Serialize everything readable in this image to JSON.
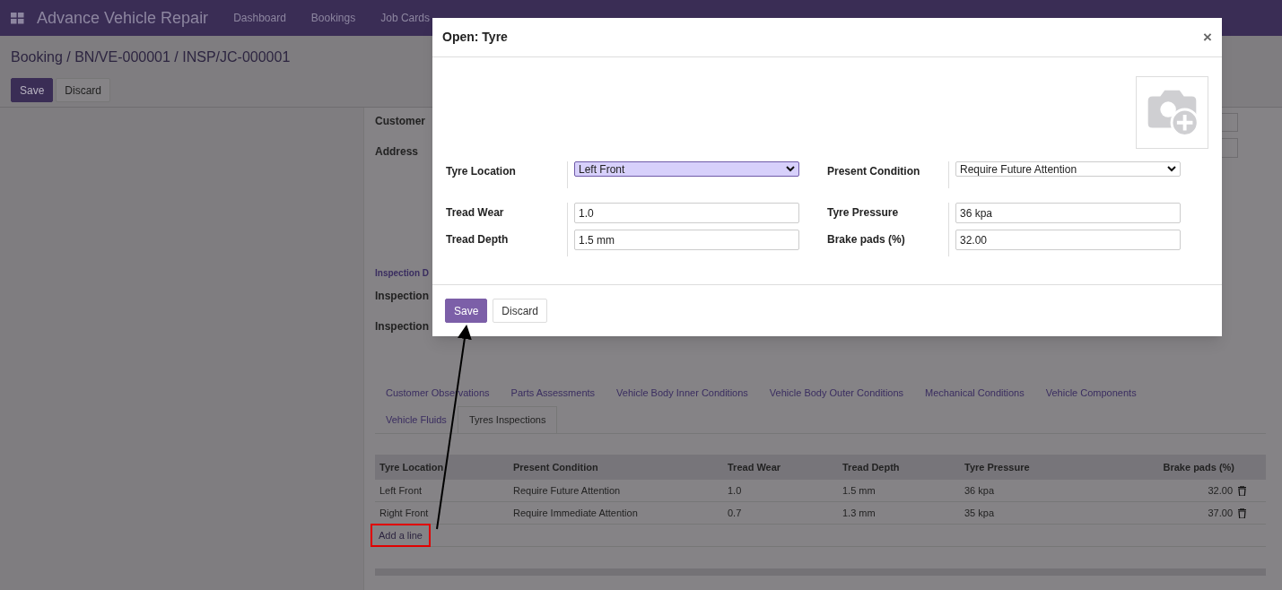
{
  "navbar": {
    "title": "Advance Vehicle Repair",
    "items": [
      "Dashboard",
      "Bookings",
      "Job Cards"
    ]
  },
  "breadcrumb": "Booking / BN/VE-000001 / INSP/JC-000001",
  "actions": [
    {
      "label": "Save",
      "kind": "primary"
    },
    {
      "label": "Discard",
      "kind": "secondary"
    }
  ],
  "form": {
    "labels": [
      "Customer",
      "Address"
    ],
    "section": "Inspection D",
    "more_labels": [
      "Inspection",
      "Inspection"
    ]
  },
  "tabs": [
    {
      "label": "Customer Observations",
      "selected": false
    },
    {
      "label": "Parts Assessments",
      "selected": false
    },
    {
      "label": "Vehicle Body Inner Conditions",
      "selected": false
    },
    {
      "label": "Vehicle Body Outer Conditions",
      "selected": false
    },
    {
      "label": "Mechanical Conditions",
      "selected": false
    },
    {
      "label": "Vehicle Components",
      "selected": false
    },
    {
      "label": "Vehicle Fluids",
      "selected": false
    },
    {
      "label": "Tyres Inspections",
      "selected": true
    }
  ],
  "table": {
    "columns": [
      "Tyre Location",
      "Present Condition",
      "Tread Wear",
      "Tread Depth",
      "Tyre Pressure",
      "Brake pads (%)"
    ],
    "rows": [
      [
        "Left Front",
        "Require Future Attention",
        "1.0",
        "1.5 mm",
        "36 kpa",
        "32.00"
      ],
      [
        "Right Front",
        "Require Immediate Attention",
        "0.7",
        "1.3 mm",
        "35 kpa",
        "37.00"
      ]
    ],
    "add_line": "Add a line"
  },
  "dialog": {
    "title": "Open: Tyre",
    "close": "×",
    "fields": [
      {
        "label": "Tyre Location",
        "kind": "select",
        "value": "Left Front",
        "focused": true
      },
      {
        "label": "Present Condition",
        "kind": "select",
        "value": "Require Future Attention",
        "focused": false
      },
      {
        "label": "Tread Wear",
        "kind": "input",
        "value": "1.0",
        "focused": false
      },
      {
        "label": "Tyre Pressure",
        "kind": "input",
        "value": "36 kpa",
        "focused": false
      },
      {
        "label": "Tread Depth",
        "kind": "input",
        "value": "1.5 mm",
        "focused": false
      },
      {
        "label": "Brake pads (%)",
        "kind": "input",
        "value": "32.00",
        "focused": false
      }
    ],
    "buttons": [
      {
        "label": "Save",
        "kind": "primary"
      },
      {
        "label": "Discard",
        "kind": "secondary"
      }
    ]
  }
}
